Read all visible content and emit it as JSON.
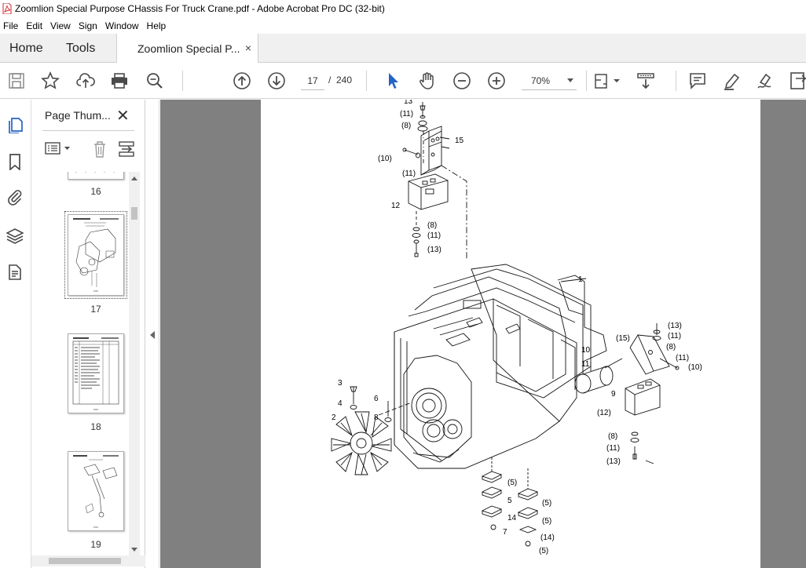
{
  "window": {
    "title": "Zoomlion Special Purpose CHassis For Truck Crane.pdf - Adobe Acrobat Pro DC (32-bit)"
  },
  "menu": [
    "File",
    "Edit",
    "View",
    "Sign",
    "Window",
    "Help"
  ],
  "tabs": {
    "home": "Home",
    "tools": "Tools",
    "document": "Zoomlion Special P...",
    "close": "×"
  },
  "toolbar": {
    "current_page": "17",
    "page_separator": "/",
    "total_pages": "240",
    "zoom": "70%"
  },
  "thumbnails_panel": {
    "title": "Page Thum...",
    "close": "✕",
    "pages": [
      "16",
      "17",
      "18",
      "19"
    ]
  },
  "drawing_labels": {
    "top": [
      "13",
      "(11)",
      "(8)",
      "15",
      "(10)",
      "(11)",
      "12",
      "(8)",
      "(11)",
      "(13)"
    ],
    "body": [
      "1",
      "3",
      "4",
      "2",
      "6",
      "8",
      "10",
      "11",
      "9"
    ],
    "right": [
      "(13)",
      "(11)",
      "(15)",
      "(8)",
      "(11)",
      "(10)",
      "(12)",
      "(8)",
      "(11)",
      "(13)"
    ],
    "bottom": [
      "(5)",
      "5",
      "(5)",
      "14",
      "(5)",
      "7",
      "(14)",
      "(5)"
    ]
  },
  "colors": {
    "viewer_bg": "#808080",
    "tab_bar": "#f0f0f0",
    "acrobat_red": "#d4242a",
    "icon_dark": "#4a4a4a",
    "active_blue": "#2463c5"
  }
}
